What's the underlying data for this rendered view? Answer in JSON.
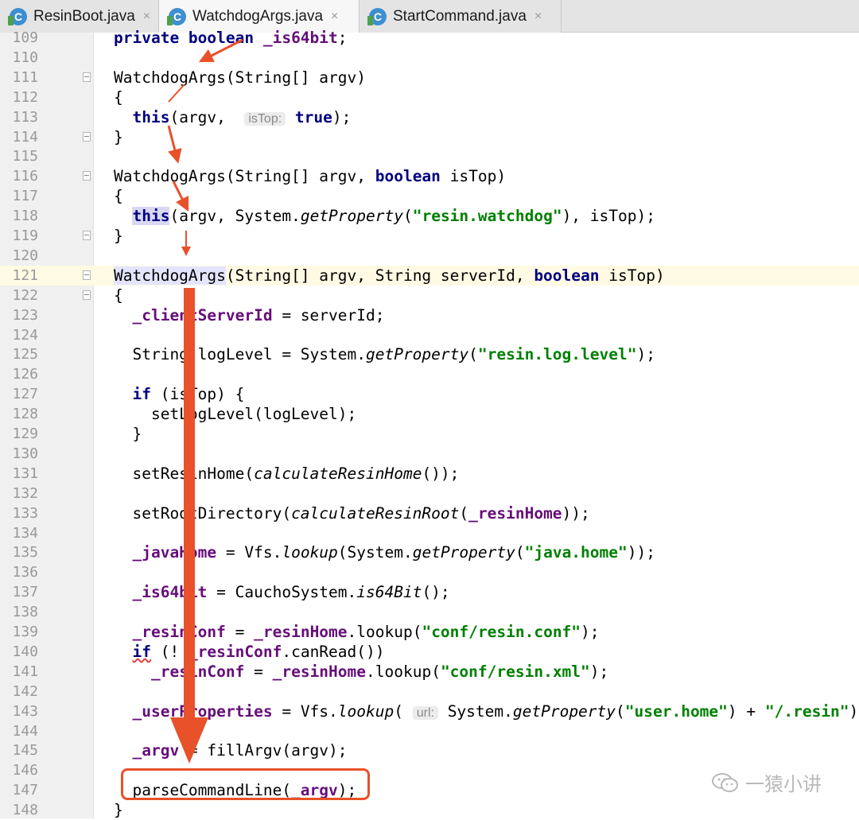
{
  "tabs": [
    {
      "label": "ResinBoot.java",
      "icon": "java-class-icon",
      "active": false
    },
    {
      "label": "WatchdogArgs.java",
      "icon": "java-class-icon",
      "active": true
    },
    {
      "label": "StartCommand.java",
      "icon": "java-class-icon",
      "active": false
    }
  ],
  "tab_close": "×",
  "editor": {
    "current_line": "121",
    "lines": [
      {
        "n": "109",
        "seg": [
          [
            "kw",
            "private boolean "
          ],
          [
            "fld",
            "_is64bit"
          ],
          [
            "",
            "; "
          ]
        ]
      },
      {
        "n": "110",
        "seg": []
      },
      {
        "n": "111",
        "seg": [
          [
            "",
            "WatchdogArgs(String[] argv)"
          ]
        ]
      },
      {
        "n": "112",
        "seg": [
          [
            "",
            "{"
          ]
        ]
      },
      {
        "n": "113",
        "seg": [
          [
            "",
            "  "
          ],
          [
            "kw",
            "this"
          ],
          [
            "",
            "(argv,  "
          ],
          [
            "hint",
            "isTop:"
          ],
          [
            "",
            " "
          ],
          [
            "kw",
            "true"
          ],
          [
            "",
            ");"
          ]
        ]
      },
      {
        "n": "114",
        "seg": [
          [
            "",
            "}"
          ]
        ]
      },
      {
        "n": "115",
        "seg": []
      },
      {
        "n": "116",
        "seg": [
          [
            "",
            "WatchdogArgs(String[] argv, "
          ],
          [
            "kw",
            "boolean"
          ],
          [
            "",
            " isTop)"
          ]
        ]
      },
      {
        "n": "117",
        "seg": [
          [
            "",
            "{"
          ]
        ]
      },
      {
        "n": "118",
        "seg": [
          [
            "",
            "  "
          ],
          [
            "kwthis",
            "this"
          ],
          [
            "",
            "(argv, System."
          ],
          [
            "ital",
            "getProperty"
          ],
          [
            "",
            "("
          ],
          [
            "str",
            "\"resin.watchdog\""
          ],
          [
            "",
            "), isTop);"
          ]
        ]
      },
      {
        "n": "119",
        "seg": [
          [
            "",
            "}"
          ]
        ]
      },
      {
        "n": "120",
        "seg": []
      },
      {
        "n": "121",
        "seg": [
          [
            "name",
            "WatchdogArgs"
          ],
          [
            "",
            "(String[] argv, String serverId, "
          ],
          [
            "kw",
            "boolean"
          ],
          [
            "",
            " isTop)"
          ]
        ]
      },
      {
        "n": "122",
        "seg": [
          [
            "",
            "{"
          ]
        ]
      },
      {
        "n": "123",
        "seg": [
          [
            "",
            "  "
          ],
          [
            "fld",
            "_clientServerId"
          ],
          [
            "",
            " = serverId;"
          ]
        ]
      },
      {
        "n": "124",
        "seg": []
      },
      {
        "n": "125",
        "seg": [
          [
            "",
            "  String logLevel = System."
          ],
          [
            "ital",
            "getProperty"
          ],
          [
            "",
            "("
          ],
          [
            "str",
            "\"resin.log.level\""
          ],
          [
            "",
            ");"
          ]
        ]
      },
      {
        "n": "126",
        "seg": []
      },
      {
        "n": "127",
        "seg": [
          [
            "",
            "  "
          ],
          [
            "kw",
            "if"
          ],
          [
            "",
            " (isTop) {"
          ]
        ]
      },
      {
        "n": "128",
        "seg": [
          [
            "",
            "    setLogLevel(logLevel);"
          ]
        ]
      },
      {
        "n": "129",
        "seg": [
          [
            "",
            "  }"
          ]
        ]
      },
      {
        "n": "130",
        "seg": []
      },
      {
        "n": "131",
        "seg": [
          [
            "",
            "  setResinHome("
          ],
          [
            "ital",
            "calculateResinHome"
          ],
          [
            "",
            "());"
          ]
        ]
      },
      {
        "n": "132",
        "seg": []
      },
      {
        "n": "133",
        "seg": [
          [
            "",
            "  setRootDirectory("
          ],
          [
            "ital",
            "calculateResinRoot"
          ],
          [
            "",
            "("
          ],
          [
            "fld",
            "_resinHome"
          ],
          [
            "",
            "));"
          ]
        ]
      },
      {
        "n": "134",
        "seg": []
      },
      {
        "n": "135",
        "seg": [
          [
            "",
            "  "
          ],
          [
            "fld",
            "_javaHome"
          ],
          [
            "",
            " = Vfs."
          ],
          [
            "ital",
            "lookup"
          ],
          [
            "",
            "(System."
          ],
          [
            "ital",
            "getProperty"
          ],
          [
            "",
            "("
          ],
          [
            "str",
            "\"java.home\""
          ],
          [
            "",
            "));"
          ]
        ]
      },
      {
        "n": "136",
        "seg": []
      },
      {
        "n": "137",
        "seg": [
          [
            "",
            "  "
          ],
          [
            "fld",
            "_is64bit"
          ],
          [
            "",
            " = CauchoSystem."
          ],
          [
            "ital",
            "is64Bit"
          ],
          [
            "",
            "();"
          ]
        ]
      },
      {
        "n": "138",
        "seg": []
      },
      {
        "n": "139",
        "seg": [
          [
            "",
            "  "
          ],
          [
            "fld",
            "_resinConf"
          ],
          [
            "",
            " = "
          ],
          [
            "fld",
            "_resinHome"
          ],
          [
            "",
            ".lookup("
          ],
          [
            "str",
            "\"conf/resin.conf\""
          ],
          [
            "",
            ");"
          ]
        ]
      },
      {
        "n": "140",
        "seg": [
          [
            "",
            "  "
          ],
          [
            "kwsq",
            "if"
          ],
          [
            "",
            " (! "
          ],
          [
            "fld",
            "_resinConf"
          ],
          [
            "",
            ".canRead())"
          ]
        ]
      },
      {
        "n": "141",
        "seg": [
          [
            "",
            "    "
          ],
          [
            "fld",
            "_resinConf"
          ],
          [
            "",
            " = "
          ],
          [
            "fld",
            "_resinHome"
          ],
          [
            "",
            ".lookup("
          ],
          [
            "str",
            "\"conf/resin.xml\""
          ],
          [
            "",
            ");"
          ]
        ]
      },
      {
        "n": "142",
        "seg": []
      },
      {
        "n": "143",
        "seg": [
          [
            "",
            "  "
          ],
          [
            "fld",
            "_userProperties"
          ],
          [
            "",
            " = Vfs."
          ],
          [
            "ital",
            "lookup"
          ],
          [
            "",
            "( "
          ],
          [
            "hint",
            "url:"
          ],
          [
            "",
            " System."
          ],
          [
            "ital",
            "getProperty"
          ],
          [
            "",
            "("
          ],
          [
            "str",
            "\"user.home\""
          ],
          [
            "",
            ") + "
          ],
          [
            "str",
            "\"/.resin\""
          ],
          [
            "",
            ");"
          ]
        ]
      },
      {
        "n": "144",
        "seg": []
      },
      {
        "n": "145",
        "seg": [
          [
            "",
            "  "
          ],
          [
            "fld",
            "_argv"
          ],
          [
            "",
            " = fillArgv(argv);"
          ]
        ]
      },
      {
        "n": "146",
        "seg": []
      },
      {
        "n": "147",
        "seg": [
          [
            "",
            "  parseCommandLine("
          ],
          [
            "fld",
            "_argv"
          ],
          [
            "",
            ");"
          ]
        ]
      },
      {
        "n": "148",
        "seg": [
          [
            "",
            "}"
          ]
        ]
      }
    ]
  },
  "watermark": {
    "text": "一猿小讲",
    "icon": "wechat-logo-icon"
  },
  "colors": {
    "arrow": "#e8512a",
    "keyword": "#000080",
    "string": "#008000",
    "field": "#660e7a",
    "current_line": "#fffae3"
  }
}
